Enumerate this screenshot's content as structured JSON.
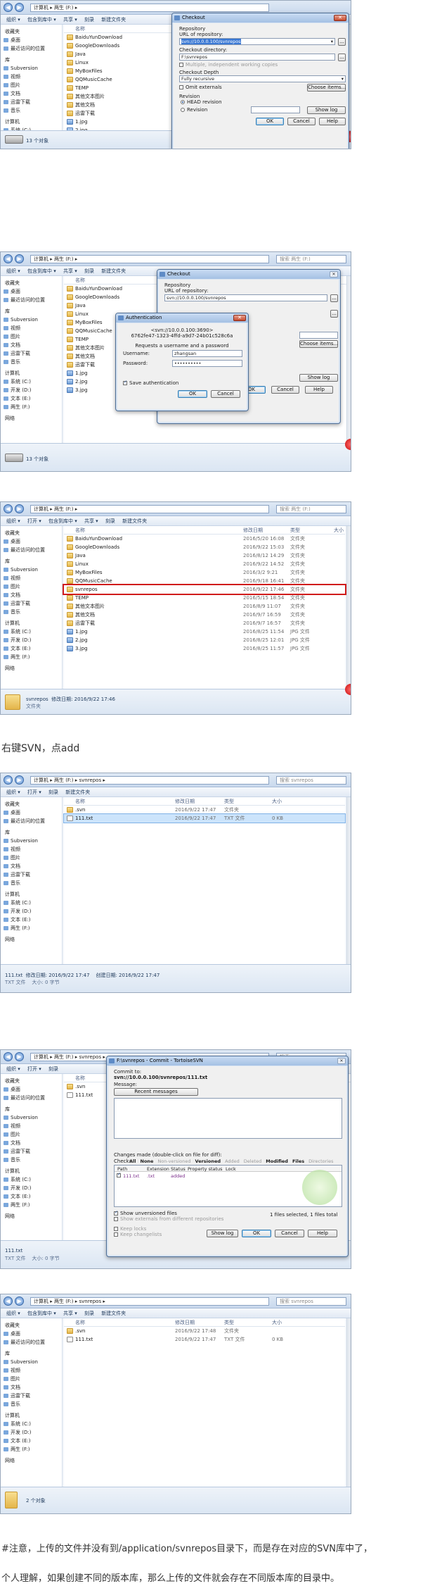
{
  "explorer": {
    "computer": "计算机",
    "drive_f": "两生 (F:)",
    "svnrepos_crumb": "svnrepos",
    "search_f": "搜索 两生 (F:)",
    "search_svnrepos": "搜索 svnrepos",
    "toolbar": {
      "organize": "组织 ▾",
      "open": "打开 ▾",
      "include": "包含到库中 ▾",
      "share": "共享 ▾",
      "burn": "刻录",
      "newfolder": "新建文件夹"
    },
    "columns": {
      "name": "名称",
      "date": "修改日期",
      "type": "类型",
      "size": "大小"
    },
    "nav": {
      "fav": "收藏夹",
      "desktop": "桌面",
      "recent": "最近访问的位置",
      "libs": "库",
      "subversion": "Subversion",
      "video": "视频",
      "pictures": "图片",
      "docs": "文档",
      "thunder": "迅雷下载",
      "music": "音乐",
      "computer": "计算机",
      "sysc": "系统 (C:)",
      "devd": "开发 (D:)",
      "texte": "文本 (E:)",
      "twof": "两生 (F:)",
      "network": "网络"
    },
    "f_items": [
      "BaiduYunDownload",
      "GoogleDownloads",
      "Java",
      "Linux",
      "MyBoxFiles",
      "QQMusicCache",
      "TEMP",
      "其他文本图片",
      "其他文档",
      "迅雷下载",
      "1.jpg",
      "2.jpg",
      "3.jpg"
    ],
    "f_items_full": [
      {
        "name": "BaiduYunDownload",
        "date": "2016/5/20 16:08",
        "type": "文件夹",
        "icon": "folder"
      },
      {
        "name": "GoogleDownloads",
        "date": "2016/9/22 15:03",
        "type": "文件夹",
        "icon": "folder"
      },
      {
        "name": "Java",
        "date": "2016/8/12 14:29",
        "type": "文件夹",
        "icon": "folder"
      },
      {
        "name": "Linux",
        "date": "2016/9/22 14:52",
        "type": "文件夹",
        "icon": "folder"
      },
      {
        "name": "MyBoxFiles",
        "date": "2016/3/2 9:21",
        "type": "文件夹",
        "icon": "folder"
      },
      {
        "name": "QQMusicCache",
        "date": "2016/9/18 16:41",
        "type": "文件夹",
        "icon": "folder"
      },
      {
        "name": "svnrepos",
        "date": "2016/9/22 17:46",
        "type": "文件夹",
        "icon": "folder",
        "boxed": true
      },
      {
        "name": "TEMP",
        "date": "2016/5/15 18:54",
        "type": "文件夹",
        "icon": "folder"
      },
      {
        "name": "其他文本图片",
        "date": "2016/8/9 11:07",
        "type": "文件夹",
        "icon": "folder"
      },
      {
        "name": "其他文档",
        "date": "2016/9/7 16:59",
        "type": "文件夹",
        "icon": "folder"
      },
      {
        "name": "迅雷下载",
        "date": "2016/9/7 16:57",
        "type": "文件夹",
        "icon": "folder"
      },
      {
        "name": "1.jpg",
        "date": "2016/8/25 11:54",
        "type": "JPG 文件",
        "icon": "jpg"
      },
      {
        "name": "2.jpg",
        "date": "2016/8/25 12:01",
        "type": "JPG 文件",
        "icon": "jpg"
      },
      {
        "name": "3.jpg",
        "date": "2016/8/25 11:57",
        "type": "JPG 文件",
        "icon": "jpg"
      }
    ],
    "repo_items_4": [
      {
        "name": ".svn",
        "date": "2016/9/22 17:47",
        "type": "文件夹",
        "size": "",
        "icon": "folder"
      },
      {
        "name": "111.txt",
        "date": "2016/9/22 17:47",
        "type": "TXT 文件",
        "size": "0 KB",
        "icon": "txt",
        "sel": true
      }
    ],
    "repo_items_6": [
      {
        "name": ".svn",
        "date": "2016/9/22 17:48",
        "type": "文件夹",
        "size": "",
        "icon": "folder"
      },
      {
        "name": "111.txt",
        "date": "2016/9/22 17:47",
        "type": "TXT 文件",
        "size": "0 KB",
        "icon": "txt"
      }
    ],
    "repo_items_5": [
      ".svn",
      "111.txt"
    ],
    "status_13": "13 个对象",
    "status_2": "2 个对象",
    "svnrepos_status": {
      "name": "svnrepos",
      "modified": "修改日期: 2016/9/22 17:46",
      "kind": "文件夹"
    },
    "txt_status": {
      "name": "111.txt",
      "modified": "修改日期: 2016/9/22 17:47",
      "created": "创建日期: 2016/9/22 17:47",
      "kind": "TXT 文件",
      "size": "大小: 0 字节"
    }
  },
  "checkout": {
    "title": "Checkout",
    "repository": "Repository",
    "url_label": "URL of repository:",
    "url_value": "svn://10.0.0.100/svnrepos",
    "dir_label": "Checkout directory:",
    "dir_value": "F:\\svnrepos",
    "multiple": "Multiple, independent working copies",
    "depth_label": "Checkout Depth",
    "depth_value": "Fully recursive",
    "omit": "Omit externals",
    "choose": "Choose items...",
    "revision_label": "Revision",
    "head": "HEAD revision",
    "revision": "Revision",
    "showlog": "Show log",
    "ok": "OK",
    "cancel": "Cancel",
    "help": "Help",
    "browse": "..."
  },
  "auth": {
    "title": "Authentication",
    "realm1": "<svn://10.0.0.100:3690>",
    "realm2": "6762fe47-1323-4ffd-a9d7-24b01c528c6a",
    "request": "Requests a username and a password",
    "user_label": "Username:",
    "user_value": "zhangsan",
    "pass_label": "Password:",
    "pass_value": "••••••••••",
    "save": "Save authentication",
    "ok": "OK",
    "cancel": "Cancel"
  },
  "commit": {
    "title": "F:\\svnrepos - Commit - TortoiseSVN",
    "commit_to": "Commit to:",
    "url": "svn://10.0.0.100/svnrepos/111.txt",
    "message": "Message:",
    "recent": "Recent messages",
    "changes": "Changes made (double-click on file for diff):",
    "check": "Check:",
    "filters": [
      "All",
      "None",
      "Non-versioned",
      "Versioned",
      "Added",
      "Deleted",
      "Modified",
      "Files",
      "Directories"
    ],
    "cols": [
      "Path",
      "Extension",
      "Status",
      "Property status",
      "Lock"
    ],
    "row": {
      "path": "111.txt",
      "ext": ".txt",
      "status": "added"
    },
    "show_unversioned": "Show unversioned files",
    "show_externals": "Show externals from different repositories",
    "summary": "1 files selected, 1 files total",
    "keep_locks": "Keep locks",
    "keep_changelists": "Keep changelists",
    "showlog": "Show log",
    "ok": "OK",
    "cancel": "Cancel",
    "help": "Help"
  },
  "captions": {
    "right_click": "右键SVN，点add",
    "note1": "#注意，上传的文件并没有到/application/svnrepos目录下，而是存在对应的SVN库中了，",
    "note2": "个人理解，如果创建不同的版本库，那么上传的文件就会存在不同版本库的目录中。"
  }
}
